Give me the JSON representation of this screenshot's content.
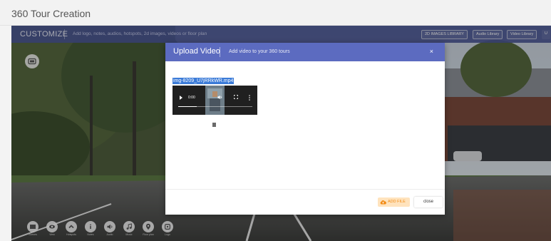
{
  "page": {
    "title": "360 Tour Creation"
  },
  "customize_bar": {
    "label": "CUSTOMIZE",
    "description": "Add logo, notes, audios, hotspots, 2d images, videos or floor plan",
    "buttons": [
      "2D IMAGES LIBRARY",
      "Audio Library",
      "Video Library",
      "U"
    ]
  },
  "tools": [
    {
      "icon": "photo-icon",
      "label": "Scenes"
    },
    {
      "icon": "eye-icon",
      "label": "View"
    },
    {
      "icon": "chevron-up-icon",
      "label": "Hotspots"
    },
    {
      "icon": "info-icon",
      "label": "Notes"
    },
    {
      "icon": "speaker-icon",
      "label": "Audio"
    },
    {
      "icon": "music-note-icon",
      "label": "Music"
    },
    {
      "icon": "map-pin-icon",
      "label": "Floor plan"
    },
    {
      "icon": "link-icon",
      "label": "Logo"
    }
  ],
  "modal": {
    "title": "Upload Video",
    "subtitle": "Add video to your 360 tours",
    "close_symbol": "×",
    "file_name": "img-8209_U7jRRkWR.mp4",
    "video": {
      "time": "0:00",
      "progress": 0.25
    },
    "add_file_label": "ADD FILE",
    "close_label": "close"
  },
  "colors": {
    "accent": "#5c6bc0",
    "customize_bar": "#4c5896",
    "add_file_bg": "#ffe3bd",
    "add_file_text": "#f28c16",
    "selection": "#3b7bd8"
  }
}
